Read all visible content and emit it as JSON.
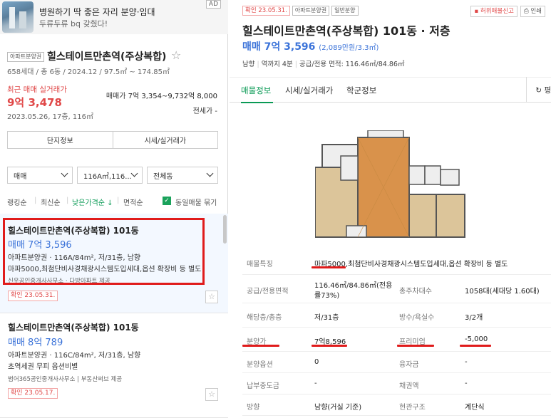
{
  "ad": {
    "badge": "AD",
    "title": "병원하기 딱 좋은 자리 분양·임대",
    "subtitle": "두류두류 bq 갖췄다!"
  },
  "complex": {
    "tag": "아파트분양권",
    "name": "힐스테이트만촌역(주상복합)",
    "info": "658세대 / 총 6동 / 2024.12 / 97.5㎡ ~ 174.85㎡",
    "recent_label": "최근 매매 실거래가",
    "recent_price": "9억 3,478",
    "recent_date": "2023.05.26, 17층, 116㎡",
    "sale_label": "매매가",
    "sale_value": "7억 3,354~9,732억 8,000",
    "jeonse": "전세가 -",
    "btn_info": "단지정보",
    "btn_trade": "시세/실거래가"
  },
  "filters": {
    "type": "매매",
    "area": "116A㎡,116...",
    "dong": "전체동"
  },
  "sort": {
    "ranking": "랭킹순",
    "latest": "최신순",
    "price_low": "낮은가격순 ↓",
    "area": "면적순",
    "group": "동일매물 묶기"
  },
  "listings": [
    {
      "name": "힐스테이트만촌역(주상복합) 101동",
      "price": "매매 7억 3,596",
      "spec": "아파트분양권 · 116A/84m², 저/31층, 남향",
      "features": "마파5000,최첨단비사경채광시스템도입세대,옵션 확장비 등 별도",
      "agent": "신우공인중개사사무소 · 다방아파트 제공",
      "confirm": "확인 23.05.31."
    },
    {
      "name": "힐스테이트만촌역(주상복합) 101동",
      "price": "매매 8억 789",
      "spec": "아파트분양권 · 116C/84m², 저/31층, 남향",
      "features": "초역세권 무피 옵션비별",
      "agent": "범어365공인중개사사무소 | 부동산써브 제공",
      "confirm": "확인 23.05.17."
    }
  ],
  "detail": {
    "confirm": "확인 23.05.31.",
    "tag1": "아파트분양권",
    "tag2": "일반분양",
    "report": "허위매물신고",
    "print": "인쇄",
    "title": "힐스테이트만촌역(주상복합) 101동 · 저층",
    "price": "매매 7억 3,596",
    "price_per": "(2,089만원/3.3㎡)",
    "info_dir": "남향",
    "info_dist": "역까지 4분",
    "info_area": "공급/전용 면적: 116.46㎡/84.86㎡",
    "tab1": "매물정보",
    "tab2": "시세/실거래가",
    "tab3": "학군정보",
    "tab_more": "↻ 평",
    "rows": {
      "feature_k": "매물특징",
      "feature_v": "마파5000,최첨단비사경채광시스템도입세대,옵션 확장비 등 별도",
      "area_k": "공급/전용면적",
      "area_v1": "116.46㎡/84.86㎡(전용",
      "area_v2": "률73%)",
      "floors_k": "총주차대수",
      "floors_v": "1058대(세대당 1.60대)",
      "floor_k": "해당층/총층",
      "floor_v": "저/31층",
      "rooms_k": "방수/욕실수",
      "rooms_v": "3/2개",
      "presale_k": "분양가",
      "presale_v": "7억8,596",
      "premium_k": "프리미엄",
      "premium_v": "-5,000",
      "option_k": "분양옵션",
      "option_v": "0",
      "loan_k": "융자금",
      "loan_v": "-",
      "paid_k": "납부중도금",
      "paid_v": "-",
      "bond_k": "채권액",
      "bond_v": "-",
      "dir_k": "방향",
      "dir_v": "남향(거실 기준)",
      "struct_k": "현관구조",
      "struct_v": "계단식"
    }
  },
  "colors": {
    "accent_green": "#0a9a55",
    "price_blue": "#3b73d9",
    "alert_red": "#e04848",
    "highlight_red": "#e01b1b"
  }
}
